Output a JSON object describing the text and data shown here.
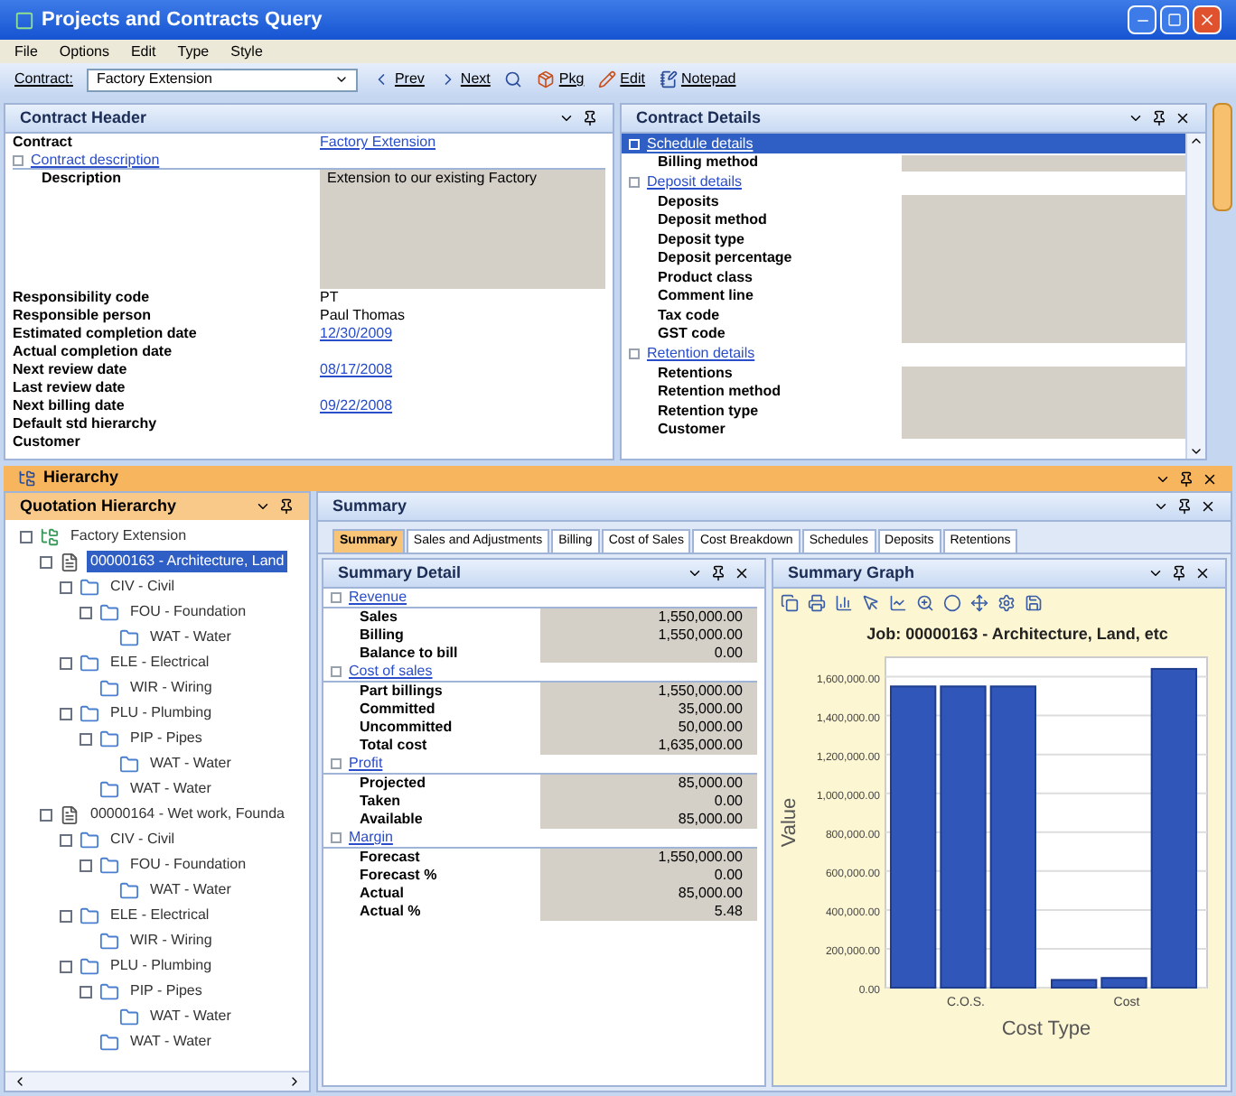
{
  "window": {
    "title": "Projects and Contracts Query"
  },
  "menu": [
    "File",
    "Options",
    "Edit",
    "Type",
    "Style"
  ],
  "toolbar": {
    "contract_label": "Contract:",
    "contract_value": "Factory Extension",
    "buttons": [
      {
        "kind": "prev",
        "label": "Prev"
      },
      {
        "kind": "next",
        "label": "Next"
      },
      {
        "kind": "search"
      },
      {
        "kind": "pkg",
        "label": "Pkg"
      },
      {
        "kind": "edit",
        "label": "Edit"
      },
      {
        "kind": "notepad",
        "label": "Notepad"
      }
    ]
  },
  "contract_header": {
    "title": "Contract Header",
    "rows": [
      {
        "kind": "field",
        "label": "Contract",
        "value": "Factory Extension",
        "link": true
      },
      {
        "kind": "section",
        "label": "Contract description"
      },
      {
        "kind": "memo",
        "label": "Description",
        "value": "Extension to our existing Factory"
      },
      {
        "kind": "field",
        "label": "Responsibility code",
        "value": "PT",
        "link": false
      },
      {
        "kind": "field",
        "label": "Responsible person",
        "value": "Paul Thomas",
        "link": false
      },
      {
        "kind": "field",
        "label": "Estimated completion date",
        "value": "12/30/2009",
        "link": true
      },
      {
        "kind": "field",
        "label": "Actual completion date"
      },
      {
        "kind": "field",
        "label": "Next review date",
        "value": "08/17/2008",
        "link": true
      },
      {
        "kind": "field",
        "label": "Last review date"
      },
      {
        "kind": "field",
        "label": "Next billing date",
        "value": "09/22/2008",
        "link": true
      },
      {
        "kind": "field",
        "label": "Default std hierarchy"
      },
      {
        "kind": "field",
        "label": "Customer"
      }
    ]
  },
  "contract_details": {
    "title": "Contract Details",
    "sections": [
      {
        "title": "Schedule details",
        "selected": true,
        "rows": [
          "Billing method"
        ]
      },
      {
        "title": "Deposit details",
        "selected": false,
        "rows": [
          "Deposits",
          "Deposit method",
          "Deposit type",
          "Deposit percentage",
          "Product class",
          "Comment line",
          "Tax code",
          "GST code"
        ]
      },
      {
        "title": "Retention details",
        "selected": false,
        "rows": [
          "Retentions",
          "Retention method",
          "Retention type",
          "Customer"
        ]
      }
    ]
  },
  "hierarchy_bar": {
    "title": "Hierarchy"
  },
  "quotation_hierarchy": {
    "title": "Quotation Hierarchy",
    "tree": [
      {
        "label": "Factory Extension",
        "kind": "project",
        "selected": false,
        "children": [
          {
            "label": "00000163 - Architecture, Land",
            "kind": "job",
            "selected": true,
            "children": [
              {
                "label": "CIV - Civil",
                "kind": "folder",
                "selected": false,
                "children": [
                  {
                    "label": "FOU - Foundation",
                    "kind": "folder",
                    "selected": false,
                    "children": [
                      {
                        "label": "WAT - Water",
                        "kind": "folder",
                        "selected": false
                      }
                    ]
                  }
                ]
              },
              {
                "label": "ELE - Electrical",
                "kind": "folder",
                "selected": false,
                "children": [
                  {
                    "label": "WIR - Wiring",
                    "kind": "folder",
                    "selected": false
                  }
                ]
              },
              {
                "label": "PLU - Plumbing",
                "kind": "folder",
                "selected": false,
                "children": [
                  {
                    "label": "PIP - Pipes",
                    "kind": "folder",
                    "selected": false,
                    "children": [
                      {
                        "label": "WAT - Water",
                        "kind": "folder",
                        "selected": false
                      }
                    ]
                  },
                  {
                    "label": "WAT - Water",
                    "kind": "folder",
                    "selected": false
                  }
                ]
              }
            ]
          },
          {
            "label": "00000164 - Wet work, Founda",
            "kind": "job",
            "selected": false,
            "children": [
              {
                "label": "CIV - Civil",
                "kind": "folder",
                "selected": false,
                "children": [
                  {
                    "label": "FOU - Foundation",
                    "kind": "folder",
                    "selected": false,
                    "children": [
                      {
                        "label": "WAT - Water",
                        "kind": "folder",
                        "selected": false
                      }
                    ]
                  }
                ]
              },
              {
                "label": "ELE - Electrical",
                "kind": "folder",
                "selected": false,
                "children": [
                  {
                    "label": "WIR - Wiring",
                    "kind": "folder",
                    "selected": false
                  }
                ]
              },
              {
                "label": "PLU - Plumbing",
                "kind": "folder",
                "selected": false,
                "children": [
                  {
                    "label": "PIP - Pipes",
                    "kind": "folder",
                    "selected": false,
                    "children": [
                      {
                        "label": "WAT - Water",
                        "kind": "folder",
                        "selected": false
                      }
                    ]
                  },
                  {
                    "label": "WAT - Water",
                    "kind": "folder",
                    "selected": false
                  }
                ]
              }
            ]
          }
        ]
      }
    ]
  },
  "summary": {
    "title": "Summary",
    "tabs": [
      {
        "label": "Summary",
        "selected": true
      },
      {
        "label": "Sales and Adjustments",
        "selected": false
      },
      {
        "label": "Billing",
        "selected": false
      },
      {
        "label": "Cost of Sales",
        "selected": false
      },
      {
        "label": "Cost Breakdown",
        "selected": false
      },
      {
        "label": "Schedules",
        "selected": false
      },
      {
        "label": "Deposits",
        "selected": false
      },
      {
        "label": "Retentions",
        "selected": false
      }
    ],
    "detail": {
      "title": "Summary Detail",
      "sections": [
        {
          "title": "Revenue",
          "rows": [
            {
              "label": "Sales",
              "value": "1,550,000.00"
            },
            {
              "label": "Billing",
              "value": "1,550,000.00"
            },
            {
              "label": "Balance to bill",
              "value": "0.00"
            }
          ]
        },
        {
          "title": "Cost of sales",
          "rows": [
            {
              "label": "Part billings",
              "value": "1,550,000.00"
            },
            {
              "label": "Committed",
              "value": "35,000.00"
            },
            {
              "label": "Uncommitted",
              "value": "50,000.00"
            },
            {
              "label": "Total cost",
              "value": "1,635,000.00"
            }
          ]
        },
        {
          "title": "Profit",
          "rows": [
            {
              "label": "Projected",
              "value": "85,000.00"
            },
            {
              "label": "Taken",
              "value": "0.00"
            },
            {
              "label": "Available",
              "value": "85,000.00"
            }
          ]
        },
        {
          "title": "Margin",
          "rows": [
            {
              "label": "Forecast",
              "value": "1,550,000.00"
            },
            {
              "label": "Forecast %",
              "value": "0.00"
            },
            {
              "label": "Actual",
              "value": "85,000.00"
            },
            {
              "label": "Actual %",
              "value": "5.48"
            }
          ]
        }
      ]
    },
    "graph": {
      "title": "Summary Graph",
      "chart_data": {
        "type": "bar",
        "title": "Job: 00000163 - Architecture, Land, etc",
        "xlabel": "Cost Type",
        "ylabel": "Value",
        "categories": [
          "C.O.S.",
          "Cost"
        ],
        "series": [
          {
            "color": "#2f56b8",
            "values": [
              1550000,
              40000
            ]
          },
          {
            "color": "#2f56b8",
            "values": [
              1550000,
              50000
            ]
          },
          {
            "color": "#2f56b8",
            "values": [
              1550000,
              1640000
            ]
          }
        ],
        "grid": true,
        "ylim": [
          0,
          1700000
        ],
        "yticks": [
          {
            "value": 0,
            "label": "0.00"
          },
          {
            "value": 200000,
            "label": "200,000.00"
          },
          {
            "value": 400000,
            "label": "400,000.00"
          },
          {
            "value": 600000,
            "label": "600,000.00"
          },
          {
            "value": 800000,
            "label": "800,000.00"
          },
          {
            "value": 1000000,
            "label": "1,000,000.00"
          },
          {
            "value": 1200000,
            "label": "1,200,000.00"
          },
          {
            "value": 1400000,
            "label": "1,400,000.00"
          },
          {
            "value": 1600000,
            "label": "1,600,000.00"
          }
        ]
      }
    }
  }
}
